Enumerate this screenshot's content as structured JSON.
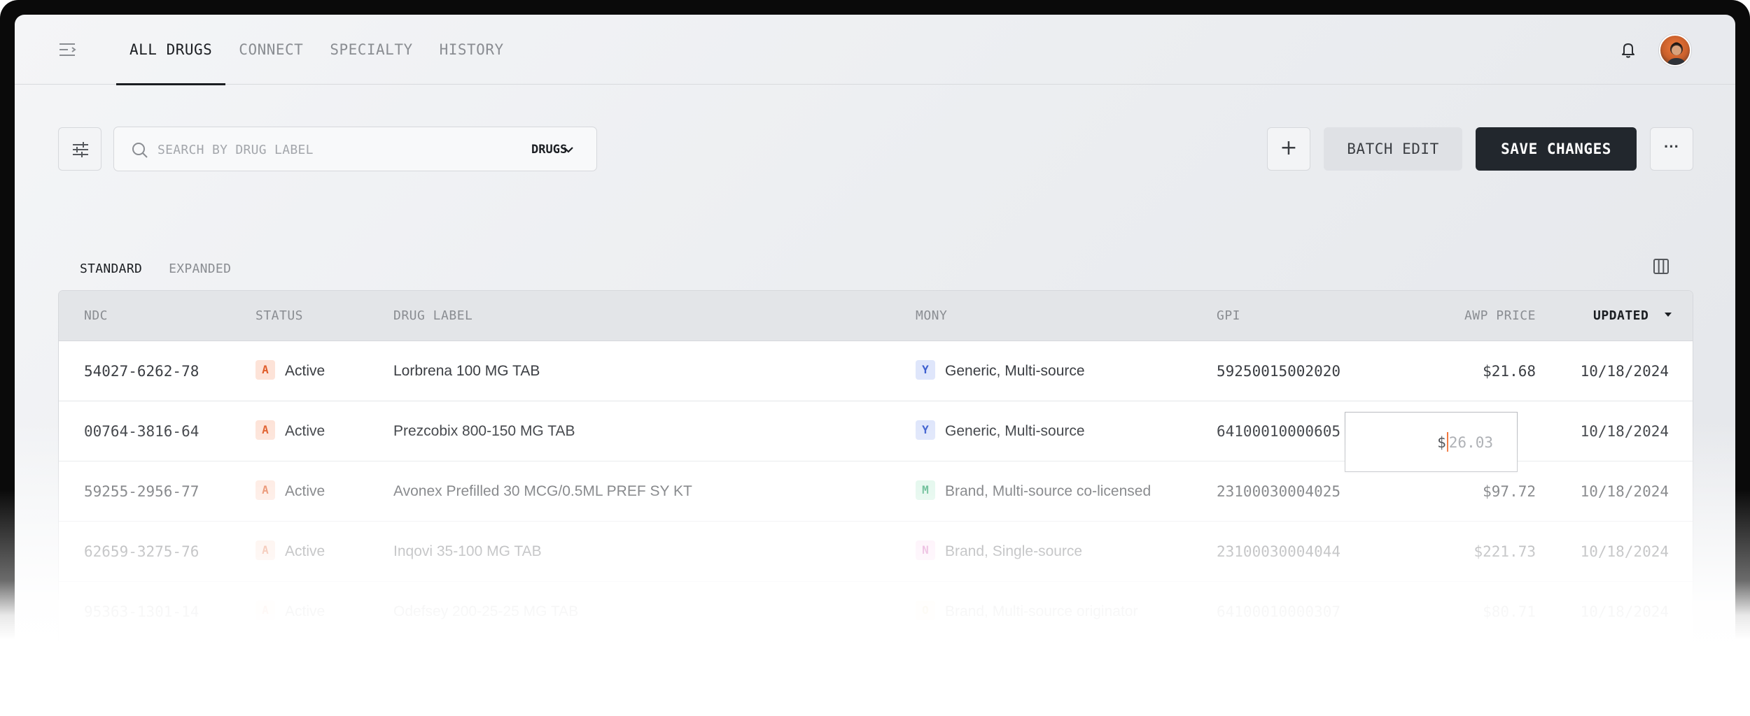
{
  "nav": {
    "tabs": [
      {
        "label": "ALL DRUGS",
        "active": true
      },
      {
        "label": "CONNECT",
        "active": false
      },
      {
        "label": "SPECIALTY",
        "active": false
      },
      {
        "label": "HISTORY",
        "active": false
      }
    ]
  },
  "toolbar": {
    "search_placeholder": "SEARCH BY DRUG LABEL",
    "search_value": "",
    "search_scope": "DRUGS",
    "batch_edit_label": "BATCH EDIT",
    "save_label": "SAVE CHANGES",
    "add_label": "+",
    "more_label": "···"
  },
  "views": {
    "standard": "STANDARD",
    "expanded": "EXPANDED",
    "active": "STANDARD"
  },
  "table": {
    "columns": {
      "ndc": "NDC",
      "status": "STATUS",
      "drug_label": "DRUG LABEL",
      "mony": "MONY",
      "gpi": "GPI",
      "awp_price": "AWP PRICE",
      "updated": "UPDATED"
    },
    "sort_column": "UPDATED",
    "sort_direction": "desc",
    "rows": [
      {
        "ndc": "54027-6262-78",
        "status_code": "A",
        "status": "Active",
        "drug_label": "Lorbrena 100 MG TAB",
        "mony_code": "Y",
        "mony": "Generic, Multi-source",
        "gpi": "59250015002020",
        "awp_price": "$21.68",
        "updated": "10/18/2024"
      },
      {
        "ndc": "00764-3816-64",
        "status_code": "A",
        "status": "Active",
        "drug_label": "Prezcobix 800-150 MG TAB",
        "mony_code": "Y",
        "mony": "Generic, Multi-source",
        "gpi": "64100010000605",
        "awp_price": "$26.03",
        "updated": "10/18/2024"
      },
      {
        "ndc": "59255-2956-77",
        "status_code": "A",
        "status": "Active",
        "drug_label": "Avonex Prefilled 30 MCG/0.5ML PREF SY KT",
        "mony_code": "M",
        "mony": "Brand, Multi-source co-licensed",
        "gpi": "23100030004025",
        "awp_price": "$97.72",
        "updated": "10/18/2024"
      },
      {
        "ndc": "62659-3275-76",
        "status_code": "A",
        "status": "Active",
        "drug_label": "Inqovi 35-100 MG TAB",
        "mony_code": "N",
        "mony": "Brand, Single-source",
        "gpi": "23100030004044",
        "awp_price": "$221.73",
        "updated": "10/18/2024"
      },
      {
        "ndc": "95363-1301-14",
        "status_code": "A",
        "status": "Active",
        "drug_label": "Odefsey 200-25-25 MG TAB",
        "mony_code": "O",
        "mony": "Brand, Multi-source originator",
        "gpi": "64100010000307",
        "awp_price": "$80.71",
        "updated": "10/18/2024"
      }
    ],
    "editing_cell": {
      "dollar": "$",
      "value": "26.03"
    }
  },
  "colors": {
    "primary": "#22272d",
    "caret": "#f06a2b",
    "status_active": "#e05d2a",
    "mony_y": "#3d5fcf",
    "mony_m": "#1f9d62",
    "mony_n": "#c93da5",
    "mony_o": "#c79a14"
  },
  "icons": {
    "menu": "menu-collapse-icon",
    "bell": "bell-icon",
    "filter": "sliders-icon",
    "search": "search-icon",
    "chevron": "chevron-down-icon",
    "columns": "columns-icon",
    "sort": "caret-down-icon"
  }
}
